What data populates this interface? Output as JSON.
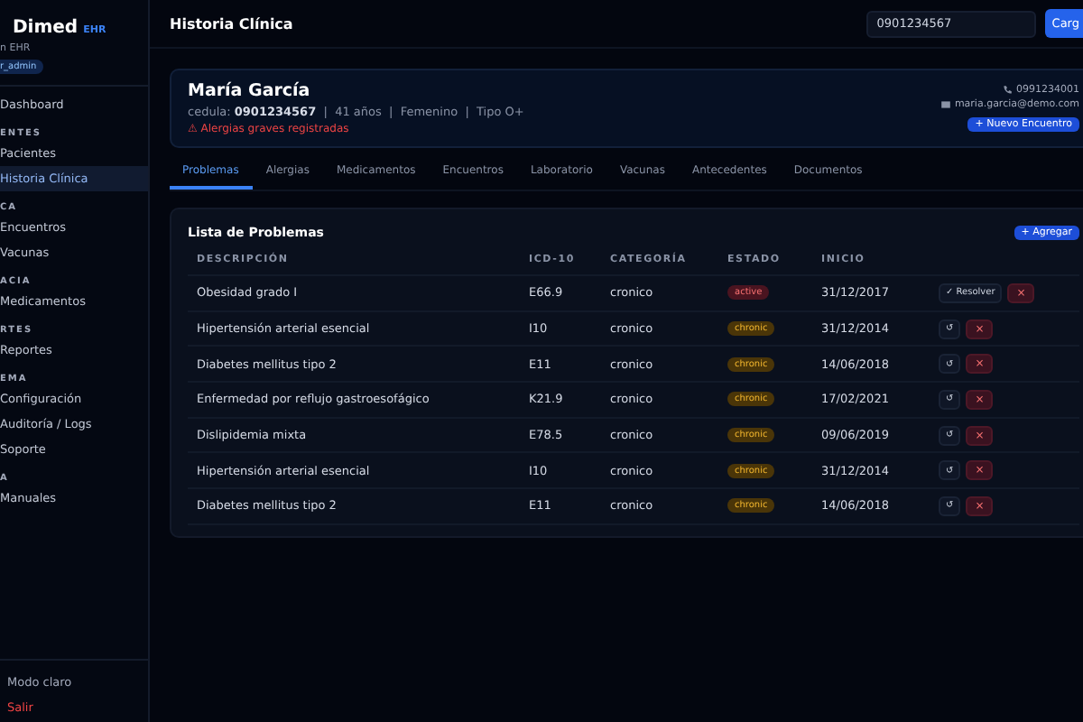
{
  "sidebar": {
    "brand": {
      "name": "Dimed",
      "tag": "EHR"
    },
    "subtitle": "n EHR",
    "role": "r_admin",
    "items": [
      {
        "kind": "link",
        "label": "Dashboard",
        "selected": false
      },
      {
        "kind": "section",
        "label": "ENTES"
      },
      {
        "kind": "link",
        "label": "Pacientes",
        "selected": false
      },
      {
        "kind": "link",
        "label": "Historia Clínica",
        "selected": true
      },
      {
        "kind": "section",
        "label": "CA"
      },
      {
        "kind": "link",
        "label": "Encuentros",
        "selected": false
      },
      {
        "kind": "link",
        "label": "Vacunas",
        "selected": false
      },
      {
        "kind": "section",
        "label": "ACIA"
      },
      {
        "kind": "link",
        "label": "Medicamentos",
        "selected": false
      },
      {
        "kind": "section",
        "label": "RTES"
      },
      {
        "kind": "link",
        "label": "Reportes",
        "selected": false
      },
      {
        "kind": "section",
        "label": "EMA"
      },
      {
        "kind": "link",
        "label": "Configuración",
        "selected": false
      },
      {
        "kind": "link",
        "label": "Auditoría / Logs",
        "selected": false
      },
      {
        "kind": "link",
        "label": "Soporte",
        "selected": false
      },
      {
        "kind": "section",
        "label": "A"
      },
      {
        "kind": "link",
        "label": "Manuales",
        "selected": false
      }
    ],
    "footer": [
      {
        "kind": "theme",
        "label": "Modo claro"
      },
      {
        "kind": "logout",
        "label": "Salir"
      }
    ]
  },
  "header": {
    "title": "Historia Clínica",
    "search": {
      "value": "0901234567"
    },
    "button": "Carg"
  },
  "patient": {
    "name": "María García",
    "details": "cedula: **0901234567**  |  41 años  |  Femenino  |  Tipo O+",
    "alert": "⚠ Alergias graves registradas",
    "phone": "0991234001",
    "email": "maria.garcia@demo.com",
    "button": "+ Nuevo Encuentro"
  },
  "tabs": [
    {
      "label": "Problemas",
      "selected": true
    },
    {
      "label": "Alergias",
      "selected": false
    },
    {
      "label": "Medicamentos",
      "selected": false
    },
    {
      "label": "Encuentros",
      "selected": false
    },
    {
      "label": "Laboratorio",
      "selected": false
    },
    {
      "label": "Vacunas",
      "selected": false
    },
    {
      "label": "Antecedentes",
      "selected": false
    },
    {
      "label": "Documentos",
      "selected": false
    }
  ],
  "problems": {
    "title": "Lista de Problemas",
    "add_button": "+ Agregar",
    "columns": [
      "DESCRIPCIÓN",
      "ICD-10",
      "CATEGORÍA",
      "ESTADO",
      "INICIO"
    ],
    "rows": [
      {
        "description": "Obesidad grado I",
        "icd": "E66.9",
        "category": "cronico",
        "status": {
          "kind": "active",
          "label": "active"
        },
        "start": "31/12/2017",
        "action": "✓ Resolver",
        "delete": "×"
      },
      {
        "description": "Hipertensión arterial esencial",
        "icd": "I10",
        "category": "cronico",
        "status": {
          "kind": "chronic",
          "label": "chronic"
        },
        "start": "31/12/2014",
        "action": "↺",
        "delete": "×"
      },
      {
        "description": "Diabetes mellitus tipo 2",
        "icd": "E11",
        "category": "cronico",
        "status": {
          "kind": "chronic",
          "label": "chronic"
        },
        "start": "14/06/2018",
        "action": "↺",
        "delete": "×"
      },
      {
        "description": "Enfermedad por reflujo gastroesofágico",
        "icd": "K21.9",
        "category": "cronico",
        "status": {
          "kind": "chronic",
          "label": "chronic"
        },
        "start": "17/02/2021",
        "action": "↺",
        "delete": "×"
      },
      {
        "description": "Dislipidemia mixta",
        "icd": "E78.5",
        "category": "cronico",
        "status": {
          "kind": "chronic",
          "label": "chronic"
        },
        "start": "09/06/2019",
        "action": "↺",
        "delete": "×"
      },
      {
        "description": "Hipertensión arterial esencial",
        "icd": "I10",
        "category": "cronico",
        "status": {
          "kind": "chronic",
          "label": "chronic"
        },
        "start": "31/12/2014",
        "action": "↺",
        "delete": "×"
      },
      {
        "description": "Diabetes mellitus tipo 2",
        "icd": "E11",
        "category": "cronico",
        "status": {
          "kind": "chronic",
          "label": "chronic"
        },
        "start": "14/06/2018",
        "action": "↺",
        "delete": "×"
      }
    ]
  }
}
